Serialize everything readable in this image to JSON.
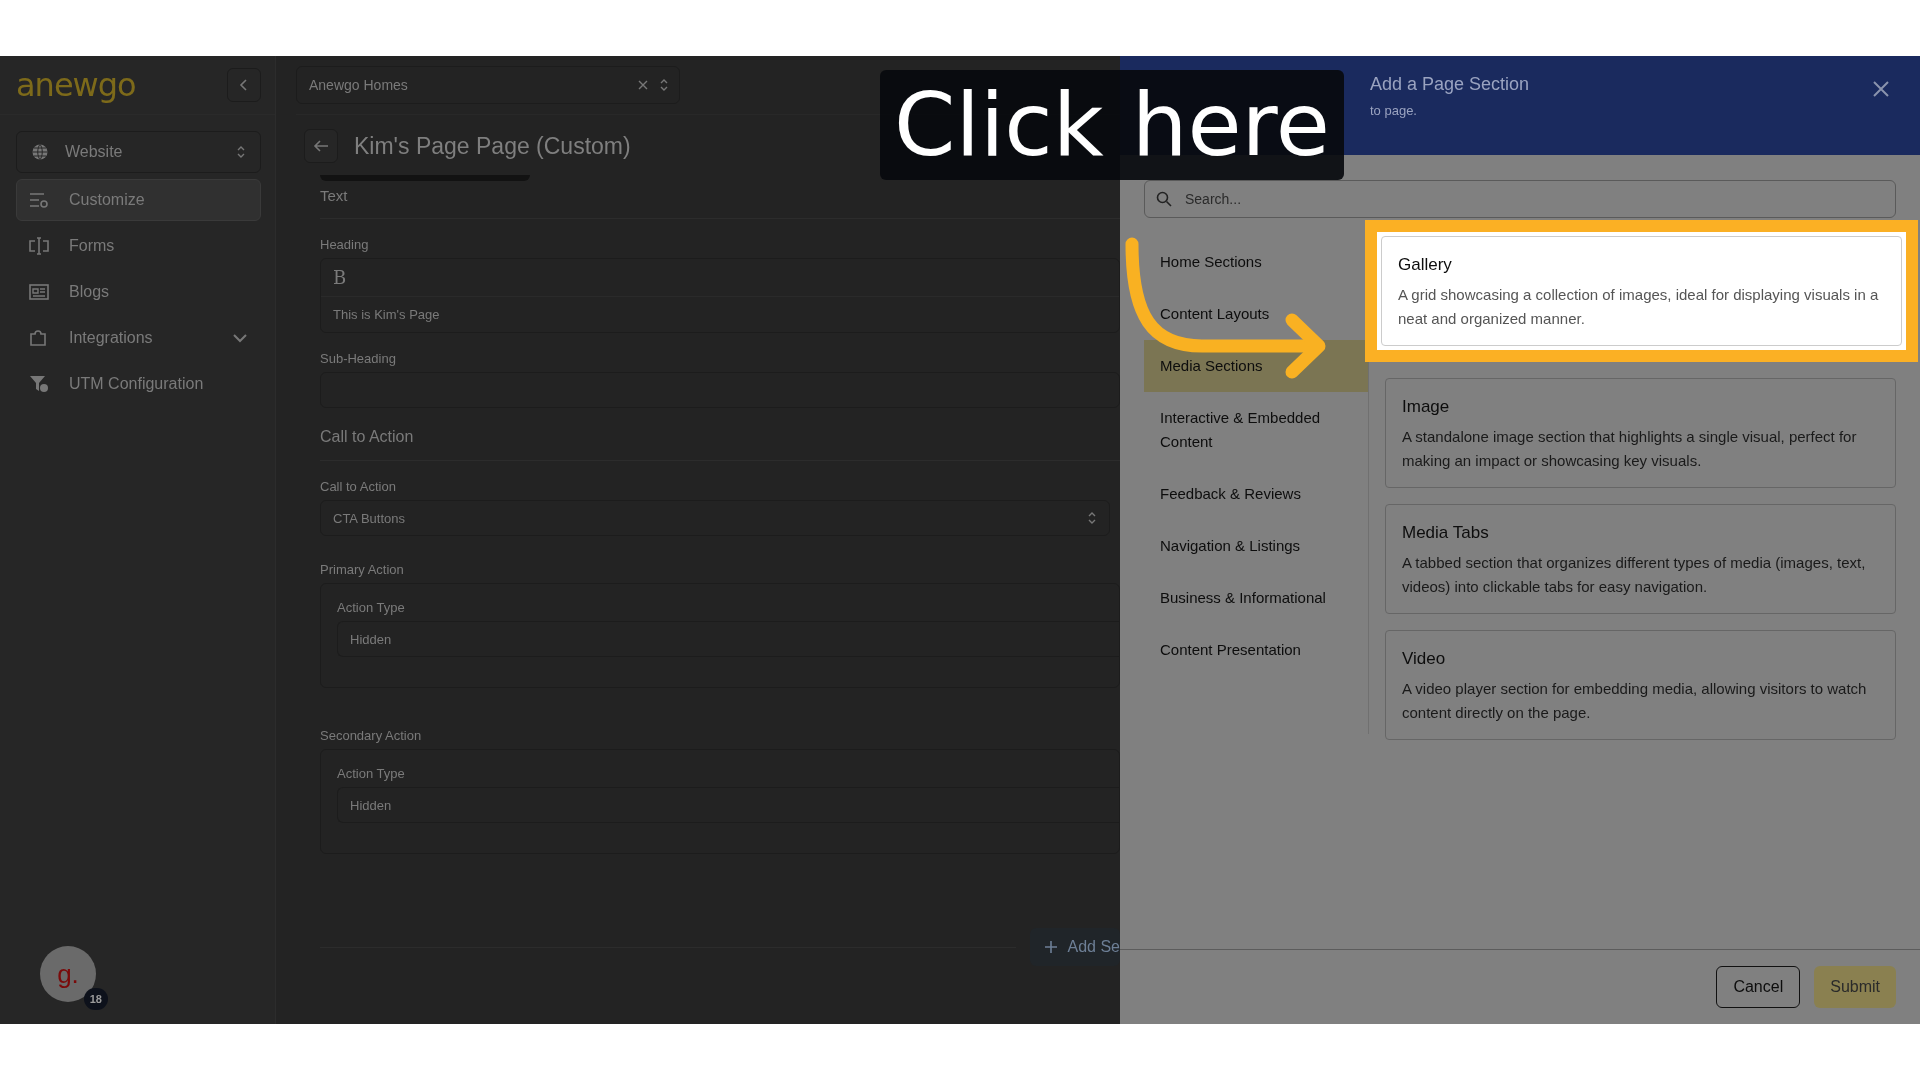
{
  "overlay": {
    "callout": "Click here"
  },
  "sidebar": {
    "logo": "anewgo",
    "switcher": "Website",
    "items": [
      {
        "label": "Customize",
        "kind": "sliders",
        "selected": true,
        "expandable": false
      },
      {
        "label": "Forms",
        "kind": "form",
        "selected": false,
        "expandable": false
      },
      {
        "label": "Blogs",
        "kind": "news",
        "selected": false,
        "expandable": false
      },
      {
        "label": "Integrations",
        "kind": "puzzle",
        "selected": false,
        "expandable": true
      },
      {
        "label": "UTM Configuration",
        "kind": "funnel",
        "selected": false,
        "expandable": false
      }
    ],
    "avatar": {
      "initial": "g.",
      "badge": "18"
    }
  },
  "topbar": {
    "site_select": "Anewgo Homes"
  },
  "page": {
    "title": "Kim's Page Page (Custom)"
  },
  "form": {
    "text_section": "Text",
    "heading_label": "Heading",
    "heading_toolbar": "B",
    "heading_value": "This is Kim's Page",
    "subheading_label": "Sub-Heading",
    "cta_section": "Call to Action",
    "cta_label": "Call to Action",
    "cta_value": "CTA Buttons",
    "actions": [
      {
        "title": "Primary Action",
        "label": "Action Type",
        "value": "Hidden"
      },
      {
        "title": "Secondary Action",
        "label": "Action Type",
        "value": "Hidden"
      }
    ],
    "add_button": "Add Se"
  },
  "panel": {
    "title": "Add a Page Section",
    "subtitle": "to page.",
    "search_placeholder": "Search...",
    "categories": [
      {
        "label": "Home Sections",
        "selected": false
      },
      {
        "label": "Content Layouts",
        "selected": false
      },
      {
        "label": "Media Sections",
        "selected": true
      },
      {
        "label": "Interactive & Embedded Content",
        "selected": false
      },
      {
        "label": "Feedback & Reviews",
        "selected": false
      },
      {
        "label": "Navigation & Listings",
        "selected": false
      },
      {
        "label": "Business & Informational",
        "selected": false
      },
      {
        "label": "Content Presentation",
        "selected": false
      }
    ],
    "sections": [
      {
        "title": "Gallery",
        "description": "A grid showcasing a collection of images, ideal for displaying visuals in a neat and organized manner.",
        "highlighted": true
      },
      {
        "title": "Image",
        "description": "A standalone image section that highlights a single visual, perfect for making an impact or showcasing key visuals.",
        "highlighted": false
      },
      {
        "title": "Media Tabs",
        "description": "A tabbed section that organizes different types of media (images, text, videos) into clickable tabs for easy navigation.",
        "highlighted": false
      },
      {
        "title": "Video",
        "description": "A video player section for embedding media, allowing visitors to watch content directly on the page.",
        "highlighted": false
      }
    ],
    "cancel": "Cancel",
    "submit": "Submit"
  }
}
